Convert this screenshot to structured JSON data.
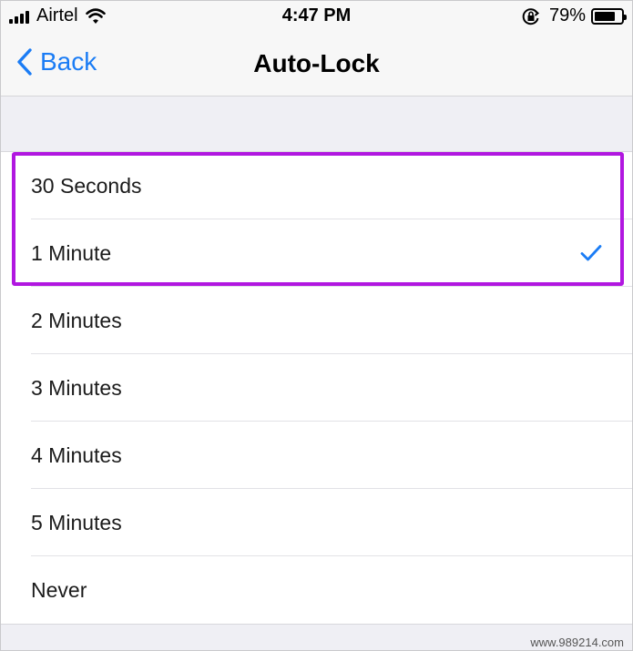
{
  "status_bar": {
    "carrier": "Airtel",
    "time": "4:47 PM",
    "battery_percent": "79%",
    "battery_level": 0.79
  },
  "nav": {
    "back_label": "Back",
    "title": "Auto-Lock"
  },
  "options": [
    {
      "label": "30 Seconds",
      "selected": false
    },
    {
      "label": "1 Minute",
      "selected": true
    },
    {
      "label": "2 Minutes",
      "selected": false
    },
    {
      "label": "3 Minutes",
      "selected": false
    },
    {
      "label": "4 Minutes",
      "selected": false
    },
    {
      "label": "5 Minutes",
      "selected": false
    },
    {
      "label": "Never",
      "selected": false
    }
  ],
  "watermark": "www.989214.com",
  "colors": {
    "accent": "#1a7cf5",
    "highlight": "#b117e0"
  }
}
